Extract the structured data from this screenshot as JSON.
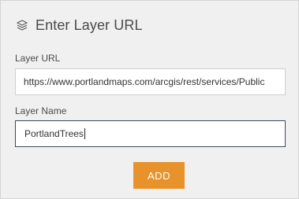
{
  "header": {
    "title": "Enter Layer URL",
    "icon": "layers-icon"
  },
  "layer_url": {
    "label": "Layer URL",
    "value": "https://www.portlandmaps.com/arcgis/rest/services/Public"
  },
  "layer_name": {
    "label": "Layer Name",
    "value": "PortlandTrees"
  },
  "add_button": {
    "label": "ADD",
    "color": "#e8922b"
  }
}
